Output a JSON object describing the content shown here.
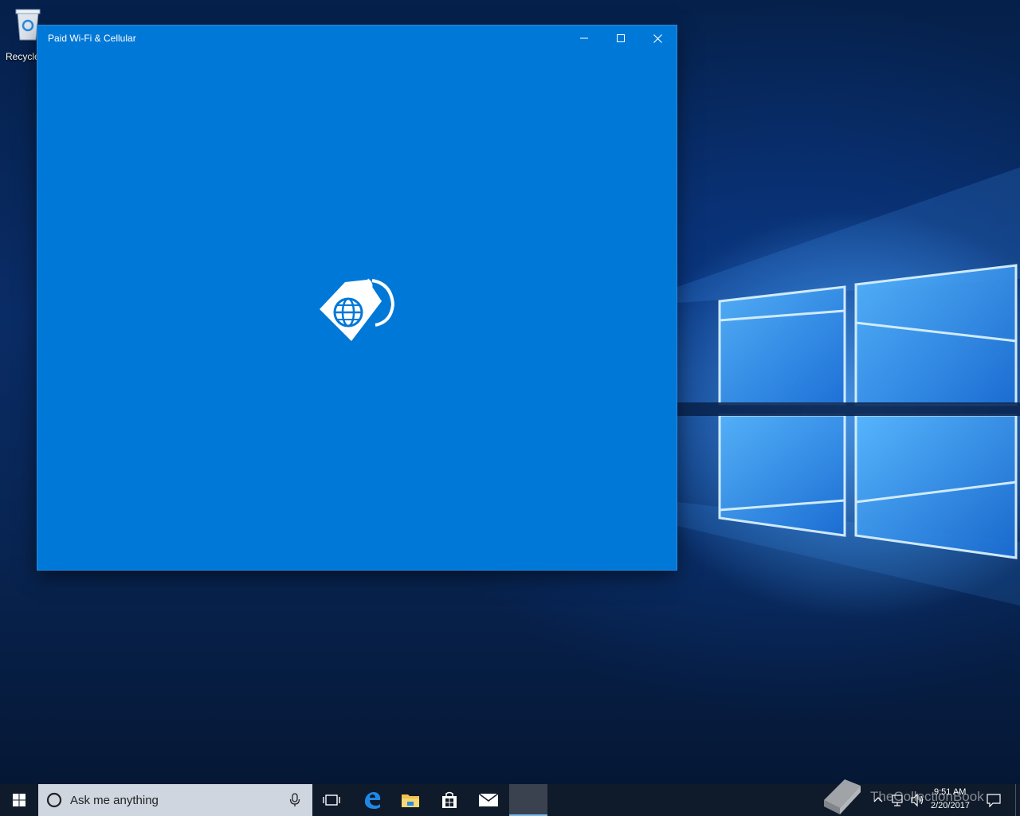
{
  "desktop": {
    "icons": [
      {
        "label": "Recycle",
        "icon": "recycle-bin-icon"
      }
    ]
  },
  "window": {
    "title": "Paid Wi-Fi & Cellular",
    "accent_color": "#0078d7",
    "controls": {
      "minimize": "minimize-icon",
      "maximize": "maximize-icon",
      "close": "close-icon"
    },
    "splash_icon": "globe-tag-icon"
  },
  "taskbar": {
    "background": "#0f1a2a",
    "start_icon": "windows-logo-icon",
    "search": {
      "placeholder": "Ask me anything"
    },
    "pinned": [
      {
        "name": "task-view",
        "icon": "task-view-icon"
      },
      {
        "name": "edge",
        "icon": "edge-icon"
      },
      {
        "name": "file-explorer",
        "icon": "folder-icon"
      },
      {
        "name": "store",
        "icon": "store-icon"
      },
      {
        "name": "mail",
        "icon": "mail-icon"
      }
    ],
    "tray": {
      "time": "9:51 AM",
      "date": "2/20/2017"
    }
  },
  "watermark": {
    "text": "TheCollectionBook"
  }
}
